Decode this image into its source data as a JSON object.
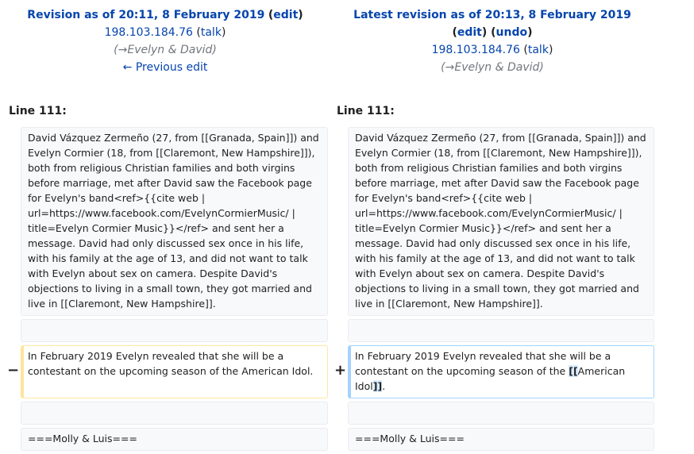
{
  "left_header": {
    "title": "Revision as of 20:11, 8 February 2019",
    "edit_label": "edit",
    "user": "198.103.184.76",
    "talk_label": "talk",
    "summary_arrow": "→",
    "summary_text": "Evelyn & David",
    "prev_edit": "← Previous edit"
  },
  "right_header": {
    "title": "Latest revision as of 20:13, 8 February 2019",
    "edit_label": "edit",
    "undo_label": "undo",
    "user": "198.103.184.76",
    "talk_label": "talk",
    "summary_arrow": "→",
    "summary_text": "Evelyn & David"
  },
  "line_label_left": "Line 111:",
  "line_label_right": "Line 111:",
  "context_paragraph": "David Vázquez Zermeño (27, from [[Granada, Spain]]) and Evelyn Cormier (18, from [[Claremont, New Hampshire]]), both from religious Christian families and both virgins before marriage, met after David saw the Facebook page for Evelyn's band<ref>{{cite web | url=https://www.facebook.com/EvelynCormierMusic/ | title=Evelyn Cormier Music}}</ref> and sent her a message. David had only discussed sex once in his life, with his family at the age of 13, and did not want to talk with Evelyn about sex on camera. Despite David's objections to living in a small town, they got married and live in [[Claremont, New Hampshire]].",
  "deleted_line": "In February 2019 Evelyn revealed that she will be a contestant on the upcoming season of the American Idol.",
  "added_line": {
    "before": "In February 2019 Evelyn revealed that she will be a contestant on the upcoming season of the ",
    "ins_open": "[[",
    "middle": "American Idol",
    "ins_close": "]]",
    "after": "."
  },
  "minus_sign": "−",
  "plus_sign": "+",
  "context_last": "===Molly & Luis==="
}
